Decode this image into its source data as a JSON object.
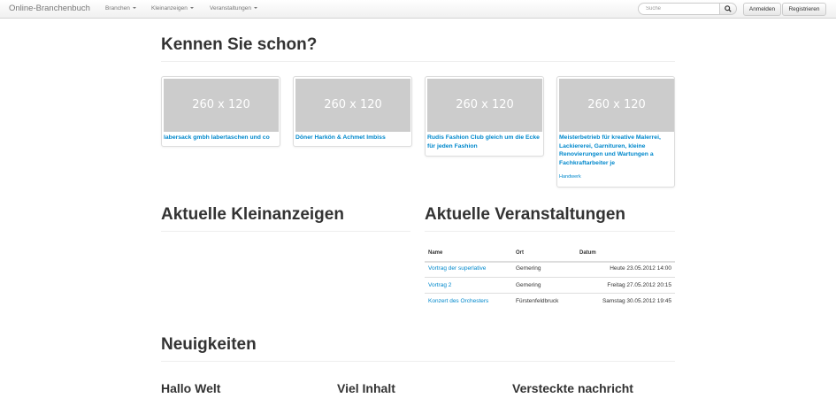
{
  "navbar": {
    "brand": "Online-Branchenbuch",
    "items": [
      {
        "label": "Branchen"
      },
      {
        "label": "Kleinanzeigen"
      },
      {
        "label": "Veranstaltungen"
      }
    ],
    "search_placeholder": "Suche",
    "login_label": "Anmelden",
    "register_label": "Registrieren"
  },
  "featured": {
    "heading": "Kennen Sie schon?",
    "items": [
      {
        "placeholder": "260 x 120",
        "title": "labersack gmbh labertaschen und co"
      },
      {
        "placeholder": "260 x 120",
        "title": "Döner Harkön & Achmet Imbiss"
      },
      {
        "placeholder": "260 x 120",
        "title": "Rudis Fashion Club gleich um die Ecke für jeden Fashion"
      },
      {
        "placeholder": "260 x 120",
        "title": "Meisterbetrieb für kreative Malerrei, Lackiererei, Garnituren, kleine Renovierungen und Wartungen a Fachkraftarbeiter je",
        "category": "Handwerk"
      }
    ]
  },
  "classifieds": {
    "heading": "Aktuelle Kleinanzeigen"
  },
  "events": {
    "heading": "Aktuelle Veranstaltungen",
    "columns": [
      "Name",
      "Ort",
      "Datum"
    ],
    "rows": [
      {
        "name": "Vortrag der superlative",
        "place": "Gemering",
        "date": "Heute 23.05.2012 14:00"
      },
      {
        "name": "Vortrag 2",
        "place": "Gemering",
        "date": "Freitag 27.05.2012 20:15"
      },
      {
        "name": "Konzert des Orchesters",
        "place": "Fürstenfeldbruck",
        "date": "Samstag 30.05.2012 19:45"
      }
    ]
  },
  "news": {
    "heading": "Neuigkeiten",
    "items": [
      {
        "title": "Hallo Welt"
      },
      {
        "title": "Viel Inhalt"
      },
      {
        "title": "Versteckte nachricht"
      }
    ]
  },
  "colors": {
    "link": "#0088cc",
    "heading": "#333333",
    "placeholder_bg": "#cccccc"
  }
}
